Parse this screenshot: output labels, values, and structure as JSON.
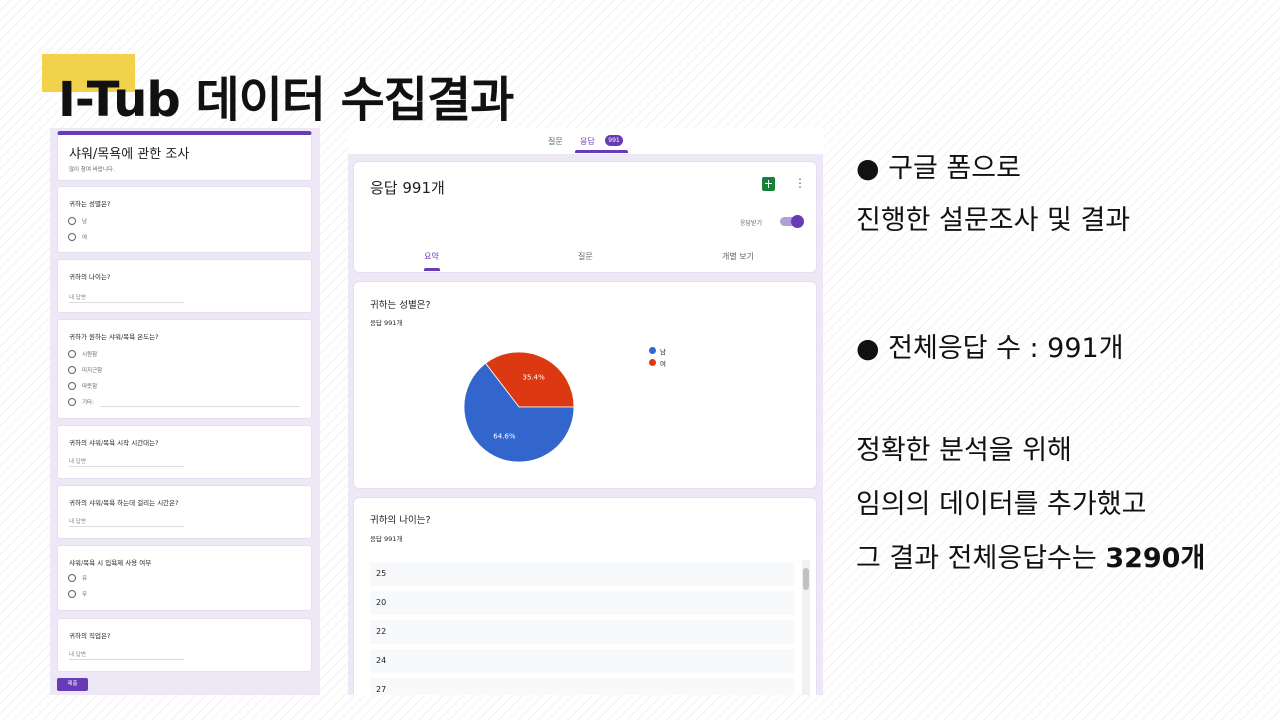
{
  "title": {
    "text": "I-Tub 데이터 수집결과",
    "accent_color": "#f2d24b"
  },
  "form": {
    "header_title": "샤워/목욕에 관한 조사",
    "header_desc": "많이 참여 바랍니다.",
    "q1": {
      "question": "귀하는 성별은?",
      "options": [
        "남",
        "여"
      ]
    },
    "q2": {
      "question": "귀하의 나이는?",
      "answer_placeholder": "내 답변"
    },
    "q3": {
      "question": "귀하가 원하는 샤워/목욕 온도는?",
      "options": [
        "시원함",
        "미지근함",
        "따뜻함",
        "기타:"
      ]
    },
    "q4": {
      "question": "귀하의 샤워/목욕 시작 시간대는?",
      "answer_placeholder": "내 답변"
    },
    "q5": {
      "question": "귀하의 샤워/목욕 하는데 걸리는 시간은?",
      "answer_placeholder": "내 답변"
    },
    "q6": {
      "question": "샤워/목욕 시 입욕제 사용 여부",
      "options": [
        "유",
        "무"
      ]
    },
    "q7": {
      "question": "귀하의 직업은?",
      "answer_placeholder": "내 답변"
    },
    "submit_label": "제출"
  },
  "responses": {
    "top_tabs": {
      "questions": "질문",
      "responses": "응답",
      "badge": "991"
    },
    "header": {
      "title": "응답 991개",
      "accepting_label": "응답받기",
      "more_icon_glyph": "⋮",
      "tabs": {
        "summary": "요약",
        "question": "질문",
        "individual": "개별 보기"
      }
    },
    "q_gender": {
      "title": "귀하는 성별은?",
      "count": "응답 991개"
    },
    "q_age": {
      "title": "귀하의 나이는?",
      "count": "응답 991개",
      "rows": [
        "25",
        "20",
        "22",
        "24",
        "27"
      ]
    }
  },
  "chart_data": {
    "type": "pie",
    "title": "귀하는 성별은?",
    "categories": [
      "남",
      "여"
    ],
    "values": [
      64.6,
      35.4
    ],
    "value_labels": [
      "64.6%",
      "35.4%"
    ],
    "colors": [
      "#3366cc",
      "#dc3912"
    ],
    "legend_position": "right"
  },
  "right_text": {
    "bullet1_line1": "● 구글 폼으로",
    "bullet1_line2": "진행한 설문조사 및 결과",
    "bullet2": "● 전체응답 수 : 991개",
    "para_line1": "정확한 분석을 위해",
    "para_line2": "임의의 데이터를 추가했고",
    "para_line3_prefix": "그 결과 전체응답수는 ",
    "para_line3_bold": "3290개"
  }
}
